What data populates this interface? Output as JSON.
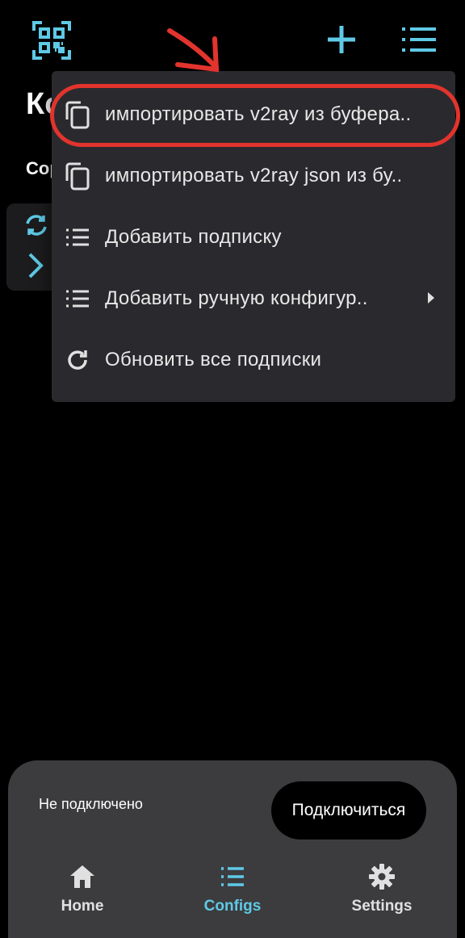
{
  "colors": {
    "accent": "#5fc9e6",
    "menu_bg": "#2a2a2e",
    "annotation": "#e2342d",
    "panel_bg": "#3c3c3e"
  },
  "top_bar": {
    "icons": [
      "qr-scan-icon",
      "plus-icon",
      "list-menu-icon"
    ]
  },
  "background_page": {
    "title": "Ко",
    "subtitle": "Сор"
  },
  "menu": {
    "items": [
      {
        "label": "импортировать v2ray из буфера..",
        "icon": "copy-icon"
      },
      {
        "label": "импортировать v2ray json из бу..",
        "icon": "copy-icon"
      },
      {
        "label": "Добавить подписку",
        "icon": "list-icon"
      },
      {
        "label": "Добавить ручную конфигур..",
        "icon": "list-icon",
        "has_submenu": true
      },
      {
        "label": "Обновить все подписки",
        "icon": "refresh-icon"
      }
    ]
  },
  "bottom": {
    "status": "Не подключено",
    "connect_label": "Подключиться",
    "nav": [
      {
        "label": "Home",
        "icon": "home-icon"
      },
      {
        "label": "Configs",
        "icon": "list-icon",
        "active": true
      },
      {
        "label": "Settings",
        "icon": "gear-icon"
      }
    ]
  }
}
